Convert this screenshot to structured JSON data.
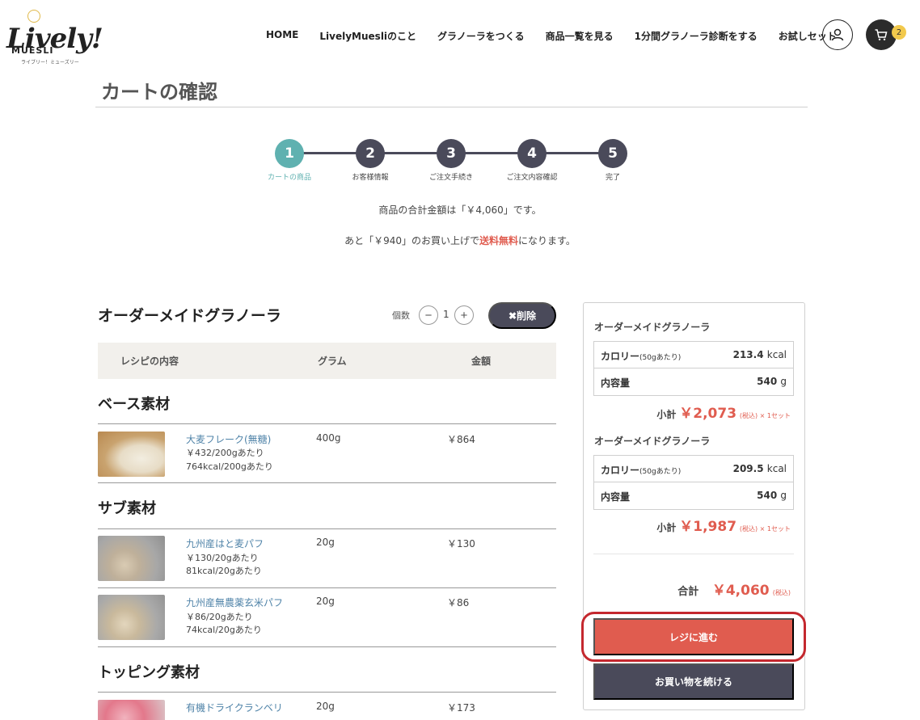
{
  "brand": {
    "logo_text": "Lively!",
    "logo_sub": "MUESLI",
    "logo_tiny": "ライブリー！ミューズリー"
  },
  "nav": [
    "HOME",
    "LivelyMuesliのこと",
    "グラノーラをつくる",
    "商品一覧を見る",
    "1分間グラノーラ診断をする",
    "お試しセット"
  ],
  "cart": {
    "count": "2"
  },
  "page": {
    "title": "カートの確認"
  },
  "steps": [
    {
      "num": "1",
      "label": "カートの商品",
      "active": true
    },
    {
      "num": "2",
      "label": "お客様情報",
      "active": false
    },
    {
      "num": "3",
      "label": "ご注文手続き",
      "active": false
    },
    {
      "num": "4",
      "label": "ご注文内容確認",
      "active": false
    },
    {
      "num": "5",
      "label": "完了",
      "active": false
    }
  ],
  "summary": {
    "line1": "商品の合計金額は「￥4,060」です。",
    "line2_pre": "あと「￥940」のお買い上げで",
    "line2_free": "送料無料",
    "line2_post": "になります。"
  },
  "product": {
    "title": "オーダーメイドグラノーラ",
    "qty_label": "個数",
    "qty_value": "1",
    "minus": "−",
    "plus": "+",
    "delete_label": "✖削除"
  },
  "table": {
    "col_recipe": "レシピの内容",
    "col_gram": "グラム",
    "col_price": "金額"
  },
  "sections": {
    "base": {
      "title": "ベース素材",
      "items": [
        {
          "name": "大麦フレーク(無糖)",
          "unit": "￥432/200gあたり",
          "kcal": "764kcal/200gあたり",
          "gram": "400g",
          "price": "￥864"
        }
      ]
    },
    "sub": {
      "title": "サブ素材",
      "items": [
        {
          "name": "九州産はと麦パフ",
          "unit": "￥130/20gあたり",
          "kcal": "81kcal/20gあたり",
          "gram": "20g",
          "price": "￥130"
        },
        {
          "name": "九州産無農薬玄米パフ",
          "unit": "￥86/20gあたり",
          "kcal": "74kcal/20gあたり",
          "gram": "20g",
          "price": "￥86"
        }
      ]
    },
    "topping": {
      "title": "トッピング素材",
      "items": [
        {
          "name": "有機ドライクランベリ",
          "gram": "20g",
          "price": "￥173"
        }
      ]
    }
  },
  "sidebar": {
    "blocks": [
      {
        "title": "オーダーメイドグラノーラ",
        "cal_label": "カロリー",
        "cal_note": "(50gあたり)",
        "cal_value": "213.4",
        "cal_unit": "kcal",
        "vol_label": "内容量",
        "vol_value": "540",
        "vol_unit": "g",
        "sub_label": "小計",
        "sub_amount": "￥2,073",
        "sub_note": "(税込) × 1セット"
      },
      {
        "title": "オーダーメイドグラノーラ",
        "cal_label": "カロリー",
        "cal_note": "(50gあたり)",
        "cal_value": "209.5",
        "cal_unit": "kcal",
        "vol_label": "内容量",
        "vol_value": "540",
        "vol_unit": "g",
        "sub_label": "小計",
        "sub_amount": "￥1,987",
        "sub_note": "(税込) × 1セット"
      }
    ],
    "total_label": "合計",
    "total_amount": "￥4,060",
    "total_note": "(税込)",
    "checkout_label": "レジに進む",
    "continue_label": "お買い物を続ける"
  },
  "colors": {
    "accent": "#5fb1b0",
    "red": "#e05c4f",
    "dark": "#4a4a5a"
  }
}
